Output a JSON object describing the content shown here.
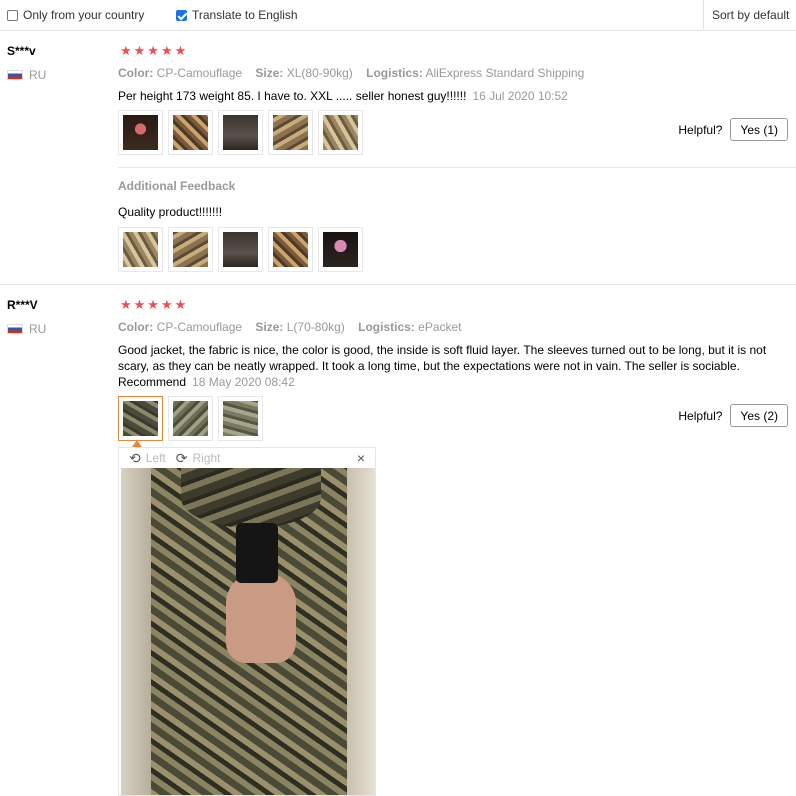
{
  "filters": {
    "only_country": {
      "label": "Only from your country",
      "checked": false
    },
    "translate": {
      "label": "Translate to English",
      "checked": true
    },
    "sort_label": "Sort by default"
  },
  "labels": {
    "color": "Color:",
    "size": "Size:",
    "logistics": "Logistics:",
    "helpful": "Helpful?",
    "additional_feedback": "Additional Feedback",
    "viewer_left": "Left",
    "viewer_right": "Right"
  },
  "reviews": [
    {
      "name": "S***v",
      "country": "RU",
      "stars": "★★★★★",
      "rating": 5,
      "color": "CP-Camouflage",
      "size": "XL(80-90kg)",
      "logistics": "AliExpress Standard Shipping",
      "text": "Per height 173 weight 85. I have to. XXL ..... seller honest guy!!!!!!",
      "date": "16 Jul 2020 10:52",
      "helpful_yes": "Yes (1)",
      "additional_text": "Quality product!!!!!!!"
    },
    {
      "name": "R***V",
      "country": "RU",
      "stars": "★★★★★",
      "rating": 5,
      "color": "CP-Camouflage",
      "size": "L(70-80kg)",
      "logistics": "ePacket",
      "text": "Good jacket, the fabric is nice, the color is good, the inside is soft fluid layer. The sleeves turned out to be long, but it is not scary, as they can be neatly wrapped. It took a long time, but the expectations were not in vain. The seller is sociable. Recommend",
      "date": "18 May 2020 08:42",
      "helpful_yes": "Yes (2)"
    }
  ],
  "icons": {
    "rotate_left": "⟲",
    "rotate_right": "⟳",
    "close": "×"
  },
  "colors": {
    "star": "#f24e4e",
    "active_thumb": "#e3893a",
    "checkbox": "#1a73e8"
  }
}
